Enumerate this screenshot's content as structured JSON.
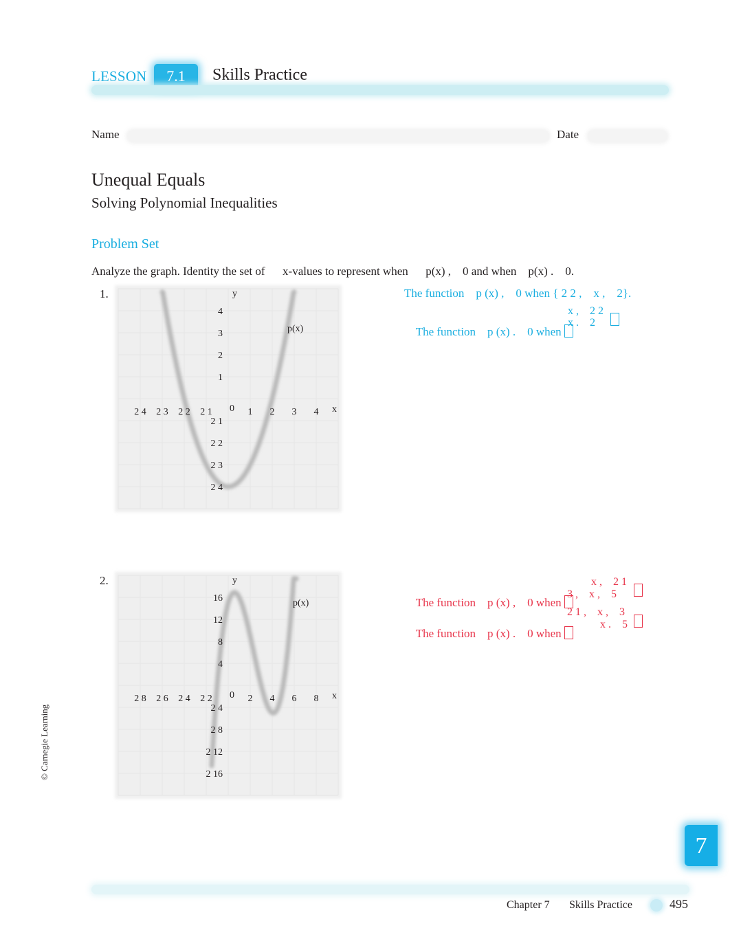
{
  "header": {
    "lesson_word": "LESSON",
    "lesson_number": "7.1",
    "title": "Skills Practice",
    "accent_color": "#1aaee0"
  },
  "form": {
    "name_label": "Name",
    "date_label": "Date"
  },
  "lesson": {
    "title": "Unequal Equals",
    "subtitle": "Solving Polynomial Inequalities"
  },
  "problem_set": {
    "heading": "Problem Set",
    "instructions": "Analyze the graph. Identity the set of      x-values to represent when      p(x) ,    0 and when    p(x) .    0."
  },
  "problems": [
    {
      "number": "1.",
      "answer_color": "#1aaee0",
      "answers": [
        {
          "prefix": "The function    p (x) ,    0 when { 2 2 ,    x ,    2}."
        },
        {
          "prefix": "The function    p (x) .    0 when ",
          "top": "x ,    2 2",
          "bottom": "x .    2"
        }
      ],
      "chart_data": {
        "type": "line",
        "title": "",
        "xlabel": "x",
        "ylabel": "y",
        "curve_label": "p(x)",
        "xlim": [
          -5,
          5
        ],
        "ylim": [
          -5,
          5
        ],
        "x_ticks": [
          -4,
          -3,
          -2,
          -1,
          1,
          2,
          3,
          4
        ],
        "x_tick_labels": [
          "2 4",
          "2 3",
          "2 2",
          "2 1",
          "1",
          "2",
          "3",
          "4"
        ],
        "y_ticks": [
          4,
          3,
          2,
          1,
          -1,
          -2,
          -3,
          -4
        ],
        "y_tick_labels": [
          "4",
          "3",
          "2",
          "1",
          "2 1",
          "2 2",
          "2 3",
          "2 4"
        ],
        "origin_label": "0",
        "grid": true,
        "series": [
          {
            "name": "p(x)",
            "formula": "x^2 - 4",
            "x_range": [
              -3,
              3
            ],
            "roots": [
              -2,
              2
            ],
            "vertex": [
              0,
              -4
            ]
          }
        ]
      }
    },
    {
      "number": "2.",
      "answer_color": "#e8344a",
      "answers": [
        {
          "prefix": "The function    p (x) ,    0 when ",
          "top": "x ,    2 1",
          "bottom": "3 ,    x ,    5"
        },
        {
          "prefix": "The function    p (x) .    0 when ",
          "top": "2 1 ,    x ,    3",
          "bottom": "x .    5"
        }
      ],
      "chart_data": {
        "type": "line",
        "title": "",
        "xlabel": "x",
        "ylabel": "y",
        "curve_label": "p(x)",
        "xlim": [
          -10,
          10
        ],
        "ylim": [
          -20,
          20
        ],
        "x_ticks": [
          -8,
          -6,
          -4,
          -2,
          2,
          4,
          6,
          8
        ],
        "x_tick_labels": [
          "2 8",
          "2 6",
          "2 4",
          "2 2",
          "2",
          "4",
          "6",
          "8"
        ],
        "y_ticks": [
          16,
          12,
          8,
          4,
          -4,
          -8,
          -12,
          -16
        ],
        "y_tick_labels": [
          "16",
          "12",
          "8",
          "4",
          "2 4",
          "2 8",
          "2 12",
          "2 16"
        ],
        "origin_label": "0",
        "grid": true,
        "series": [
          {
            "name": "p(x)",
            "formula": "(x + 1)(x - 3)(x - 5)",
            "x_range": [
              -1.5,
              6.2
            ],
            "roots": [
              -1,
              3,
              5
            ]
          }
        ]
      }
    }
  ],
  "sidebar": {
    "copyright": "© Carnegie Learning"
  },
  "chapter_tab": {
    "number": "7"
  },
  "footer": {
    "chapter": "Chapter 7",
    "section": "Skills Practice",
    "page": "495"
  }
}
